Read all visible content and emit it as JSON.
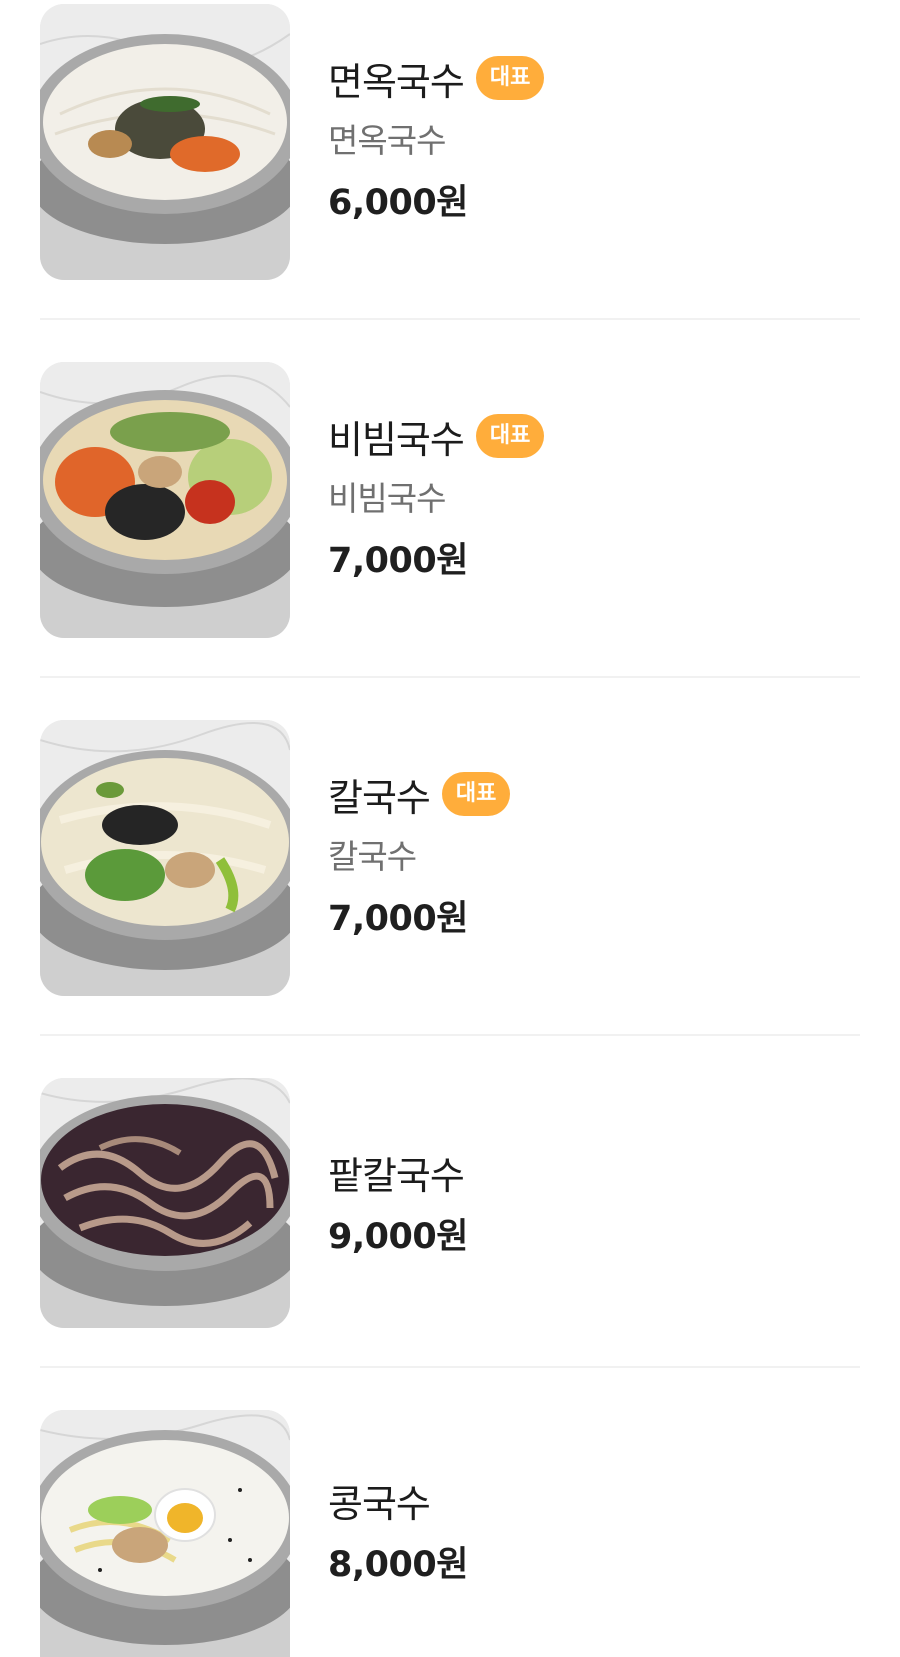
{
  "menu": {
    "items": [
      {
        "name": "면옥국수",
        "badge": "대표",
        "description": "면옥국수",
        "price": "6,000원",
        "image_icon": "noodle-bowl-icon"
      },
      {
        "name": "비빔국수",
        "badge": "대표",
        "description": "비빔국수",
        "price": "7,000원",
        "image_icon": "noodle-bowl-icon"
      },
      {
        "name": "칼국수",
        "badge": "대표",
        "description": "칼국수",
        "price": "7,000원",
        "image_icon": "noodle-bowl-icon"
      },
      {
        "name": "팥칼국수",
        "price": "9,000원",
        "image_icon": "noodle-bowl-icon"
      },
      {
        "name": "콩국수",
        "price": "8,000원",
        "image_icon": "noodle-bowl-icon"
      }
    ]
  },
  "colors": {
    "badge": "#ffad3b",
    "divider": "#f1f1f1",
    "price": "#1f1f1f",
    "description": "#707070"
  }
}
